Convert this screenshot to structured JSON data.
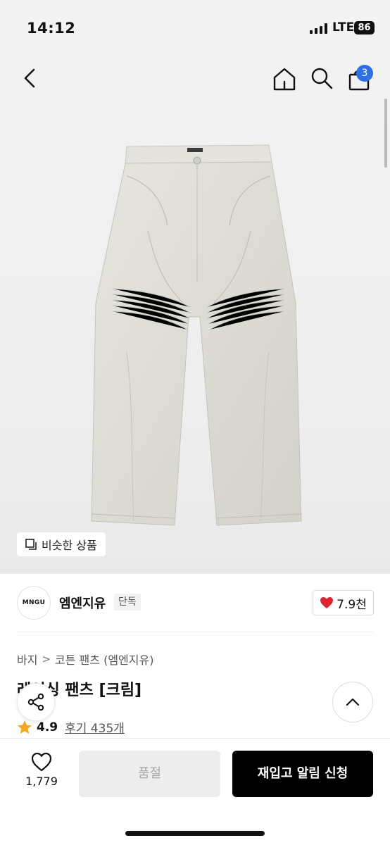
{
  "status_bar": {
    "time": "14:12",
    "network": "LTE",
    "battery": "86"
  },
  "nav": {
    "back_icon": "chevron-left-icon",
    "home_icon": "home-icon",
    "search_icon": "search-icon",
    "bag_icon": "shopping-bag-icon",
    "bag_count": "3"
  },
  "hero": {
    "similar_label": "비슷한 상품"
  },
  "brand": {
    "logo_text": "MNGU",
    "name": "엠엔지유",
    "badge": "단독",
    "likes": "7.9천"
  },
  "breadcrumb": {
    "items": [
      "바지",
      "코튼 팬츠 (엠엔지유)"
    ],
    "separator": ">"
  },
  "product": {
    "title": "레이싱 팬츠 [크림]",
    "rating": "4.9",
    "reviews": "후기 435개"
  },
  "bottom_bar": {
    "wish_count": "1,779",
    "soldout_label": "품절",
    "restock_label": "재입고 알림 신청"
  },
  "colors": {
    "accent_blue": "#2f6fe4",
    "heart_red": "#e0242f",
    "star_orange": "#f5a623",
    "primary_black": "#000000"
  }
}
